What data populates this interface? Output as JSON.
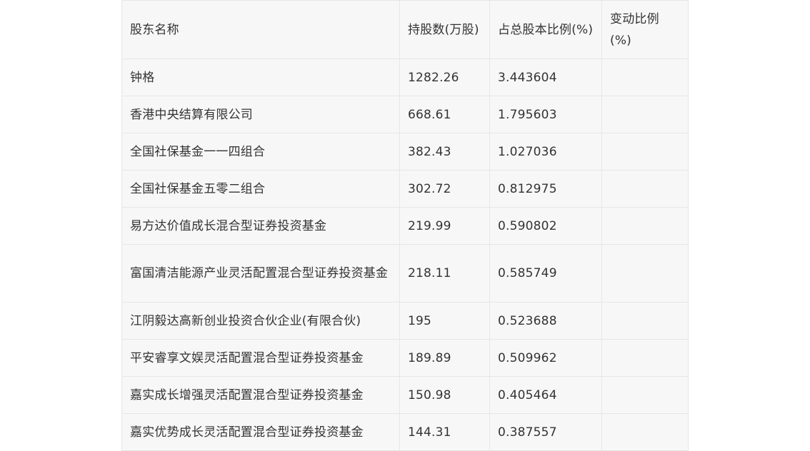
{
  "table": {
    "headers": [
      "股东名称",
      "持股数(万股)",
      "占总股本比例(%)",
      "变动比例(%)"
    ],
    "rows": [
      {
        "name": "钟格",
        "shares": "1282.26",
        "ratio": "3.443604",
        "change": ""
      },
      {
        "name": "香港中央结算有限公司",
        "shares": "668.61",
        "ratio": "1.795603",
        "change": ""
      },
      {
        "name": "全国社保基金一一四组合",
        "shares": "382.43",
        "ratio": "1.027036",
        "change": ""
      },
      {
        "name": "全国社保基金五零二组合",
        "shares": "302.72",
        "ratio": "0.812975",
        "change": ""
      },
      {
        "name": "易方达价值成长混合型证券投资基金",
        "shares": "219.99",
        "ratio": "0.590802",
        "change": ""
      },
      {
        "name": "富国清洁能源产业灵活配置混合型证券投资基金",
        "shares": "218.11",
        "ratio": "0.585749",
        "change": ""
      },
      {
        "name": "江阴毅达高新创业投资合伙企业(有限合伙)",
        "shares": "195",
        "ratio": "0.523688",
        "change": ""
      },
      {
        "name": "平安睿享文娱灵活配置混合型证券投资基金",
        "shares": "189.89",
        "ratio": "0.509962",
        "change": ""
      },
      {
        "name": "嘉实成长增强灵活配置混合型证券投资基金",
        "shares": "150.98",
        "ratio": "0.405464",
        "change": ""
      },
      {
        "name": "嘉实优势成长灵活配置混合型证券投资基金",
        "shares": "144.31",
        "ratio": "0.387557",
        "change": ""
      }
    ]
  }
}
